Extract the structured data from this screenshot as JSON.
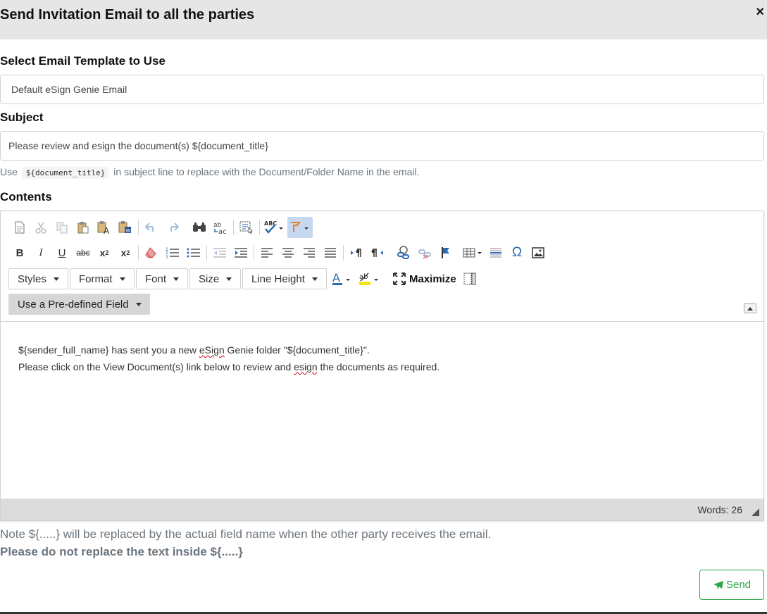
{
  "modal": {
    "title": "Send Invitation Email to all the parties",
    "close_label": "×"
  },
  "template": {
    "label": "Select Email Template to Use",
    "value": "Default eSign Genie Email"
  },
  "subject": {
    "label": "Subject",
    "value": "Please review and esign the document(s) ${document_title}",
    "hint_before": "Use",
    "hint_code": "${document_title}",
    "hint_after": "in subject line to replace with the Document/Folder Name in the email."
  },
  "contents": {
    "label": "Contents",
    "toolbar": {
      "styles": "Styles",
      "format": "Format",
      "font": "Font",
      "size": "Size",
      "line_height": "Line Height",
      "maximize": "Maximize",
      "predefined": "Use a Pre-defined Field"
    },
    "body": {
      "line1_a": "${sender_full_name} has sent you a new ",
      "line1_spell": "eSign",
      "line1_b": " Genie folder \"${document_title}\".",
      "line2_a": "Please click on the View Document(s) link below to review and ",
      "line2_spell": "esign",
      "line2_b": " the documents as required."
    },
    "word_count": "Words: 26"
  },
  "notes": {
    "note": "Note ${.....} will be replaced by the actual field name when the other party receives the email.",
    "warning": "Please do not replace the text inside ${.....}"
  },
  "send_button": "Send",
  "colors": {
    "header_bg": "#e6e6e6",
    "send_green": "#28a745",
    "status_bar": "#dcdcdc"
  },
  "icons": [
    "new-page-icon",
    "cut-icon",
    "copy-icon",
    "paste-icon",
    "paste-text-icon",
    "paste-word-icon",
    "undo-icon",
    "redo-icon",
    "find-icon",
    "replace-icon",
    "select-all-icon",
    "spellcheck-icon",
    "scayt-icon",
    "bold-icon",
    "italic-icon",
    "underline-icon",
    "strikethrough-icon",
    "subscript-icon",
    "superscript-icon",
    "remove-format-icon",
    "numbered-list-icon",
    "bulleted-list-icon",
    "outdent-icon",
    "indent-icon",
    "align-left-icon",
    "align-center-icon",
    "align-right-icon",
    "justify-icon",
    "ltr-icon",
    "rtl-icon",
    "link-icon",
    "unlink-icon",
    "anchor-icon",
    "table-icon",
    "horizontal-line-icon",
    "special-char-icon",
    "image-icon",
    "text-color-icon",
    "bg-color-icon",
    "maximize-icon",
    "show-blocks-icon"
  ]
}
